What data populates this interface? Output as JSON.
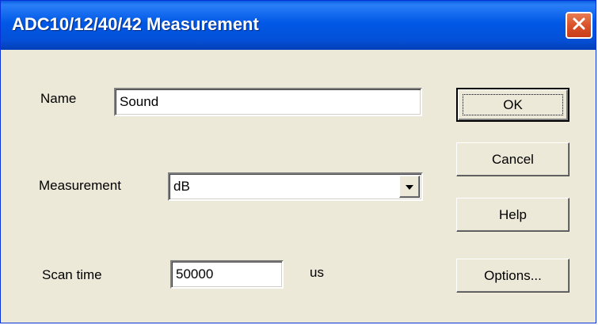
{
  "window": {
    "title": "ADC10/12/40/42 Measurement"
  },
  "form": {
    "name_label": "Name",
    "name_value": "Sound",
    "measurement_label": "Measurement",
    "measurement_value": "dB",
    "scan_time_label": "Scan time",
    "scan_time_value": "50000",
    "scan_time_unit": "us"
  },
  "buttons": {
    "ok": "OK",
    "cancel": "Cancel",
    "help": "Help",
    "options": "Options..."
  },
  "icons": {
    "close": "close-icon",
    "dropdown": "chevron-down-icon"
  },
  "colors": {
    "titlebar": "#0058e6",
    "close_button": "#d9532c",
    "dialog_background": "#ece9d8"
  }
}
